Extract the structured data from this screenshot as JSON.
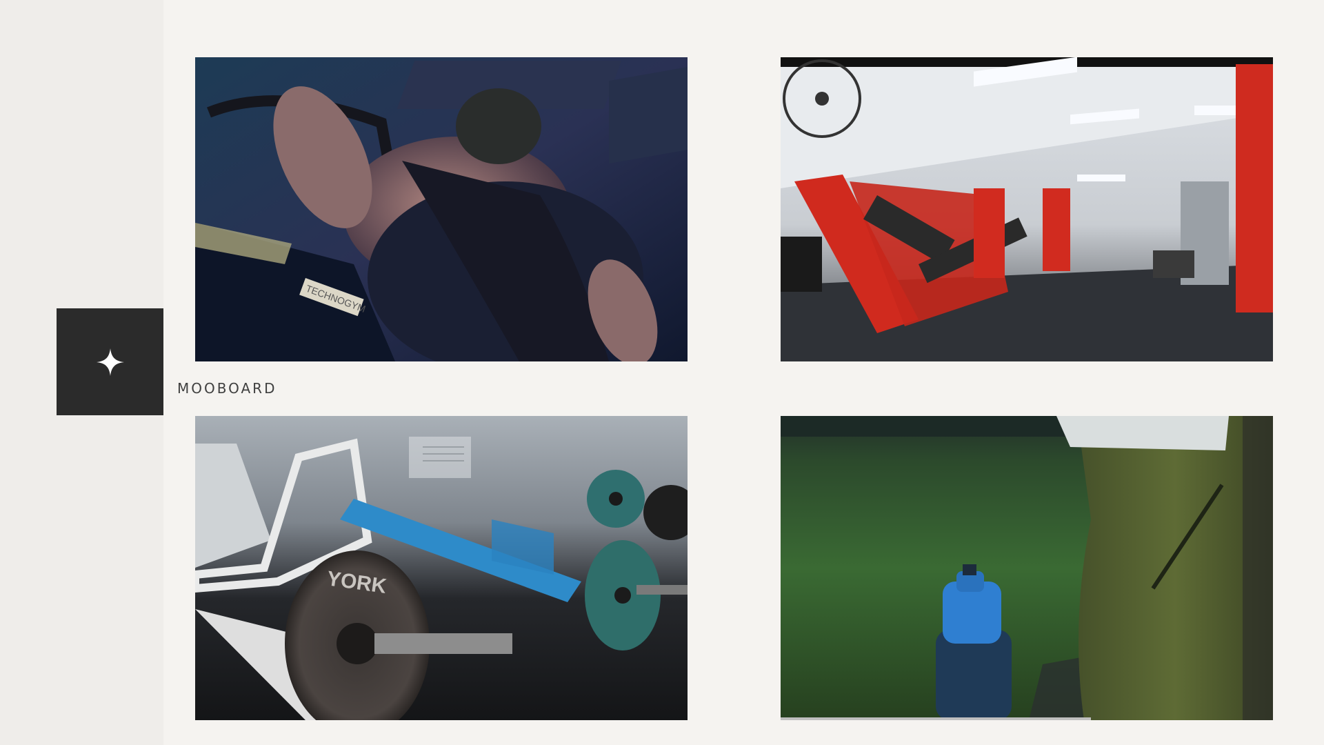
{
  "brand": {
    "name": "MOOBOARD",
    "logo_icon": "sparkle-icon"
  },
  "gallery": {
    "tiles": [
      {
        "name": "gym-back-pullup-photo",
        "icon": "photo",
        "overlay_text": "TECHNOGYM"
      },
      {
        "name": "gym-interior-red-machines-photo",
        "icon": "photo"
      },
      {
        "name": "barbell-plates-york-photo",
        "icon": "photo",
        "overlay_text": "YORK"
      },
      {
        "name": "water-bottle-green-turf-photo",
        "icon": "photo"
      }
    ]
  },
  "colors": {
    "background": "#f5f3f0",
    "rail": "#efedea",
    "logo_tile": "#2b2b2b",
    "label": "#3f3f3f"
  }
}
